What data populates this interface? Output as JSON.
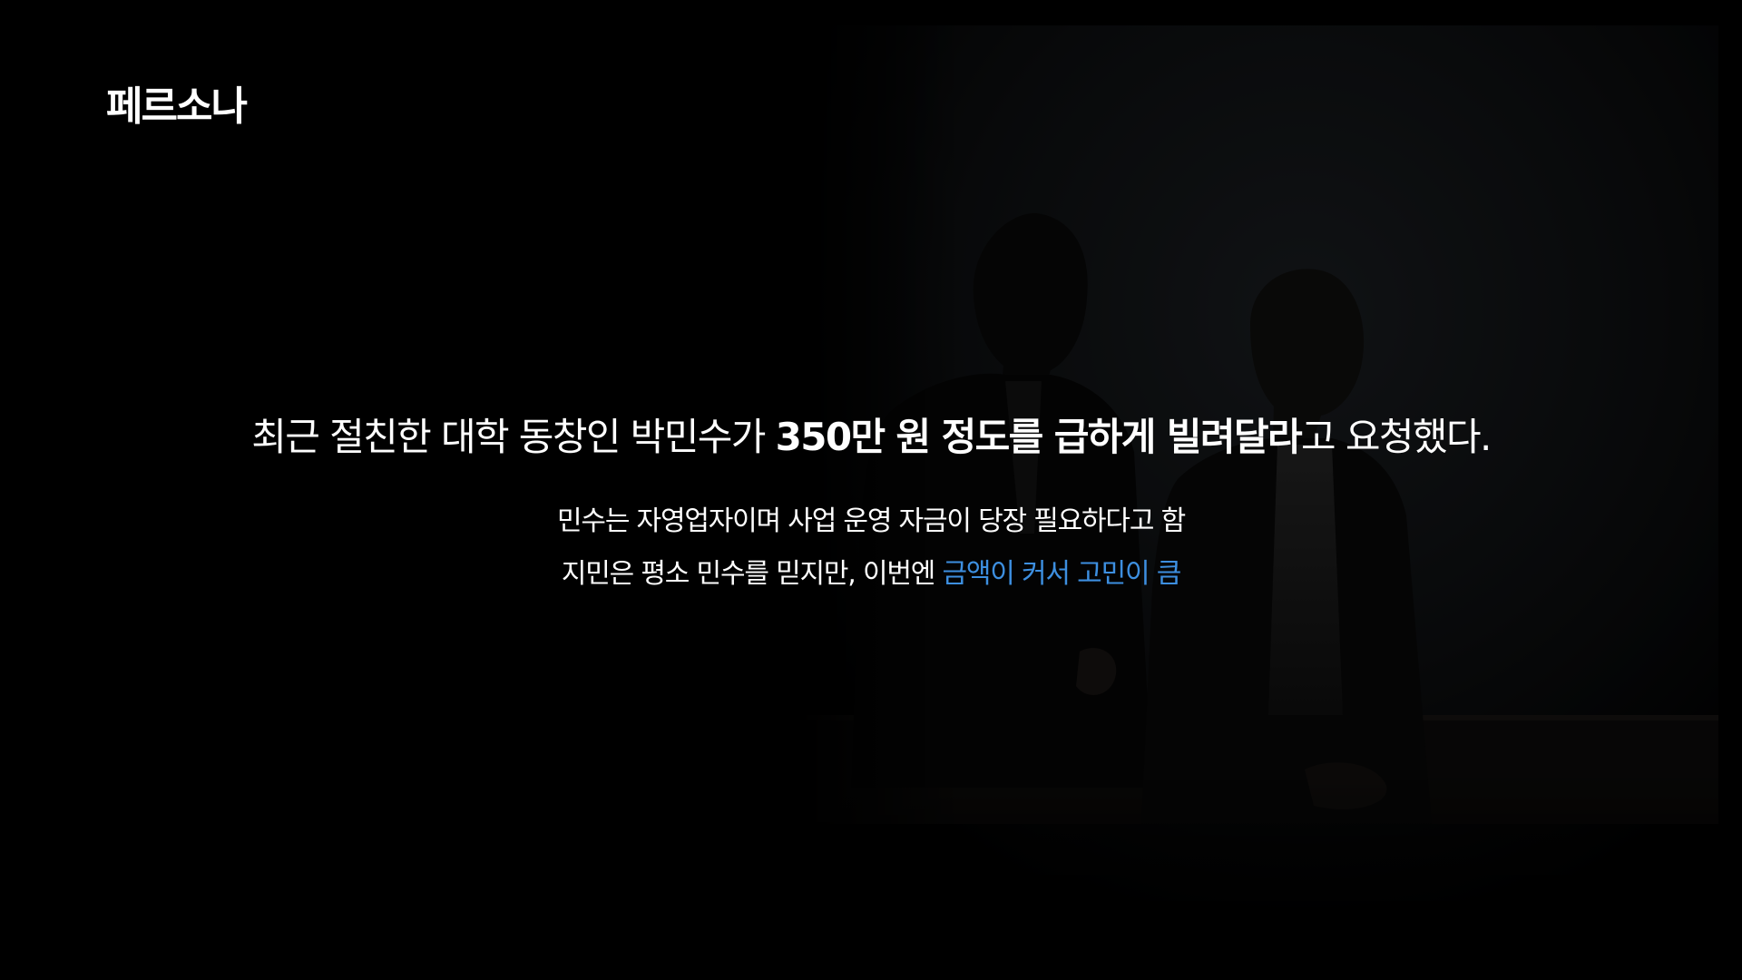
{
  "slide": {
    "section_label": "페르소나",
    "headline": {
      "prefix": "최근 절친한 대학 동창인 박민수가 ",
      "emphasis": "350만 원 정도를 급하게 빌려달라",
      "suffix": "고 요청했다."
    },
    "details": {
      "line1": "민수는 자영업자이며 사업 운영 자금이 당장 필요하다고 함",
      "line2_prefix": "지민은 평소 민수를 믿지만, 이번엔 ",
      "line2_highlight": "금액이 커서 고민이 큼"
    },
    "background_image": "two-men-in-suits-talking-dark-photo"
  },
  "colors": {
    "background": "#000000",
    "text": "#ffffff",
    "accent": "#3d8fe0"
  }
}
